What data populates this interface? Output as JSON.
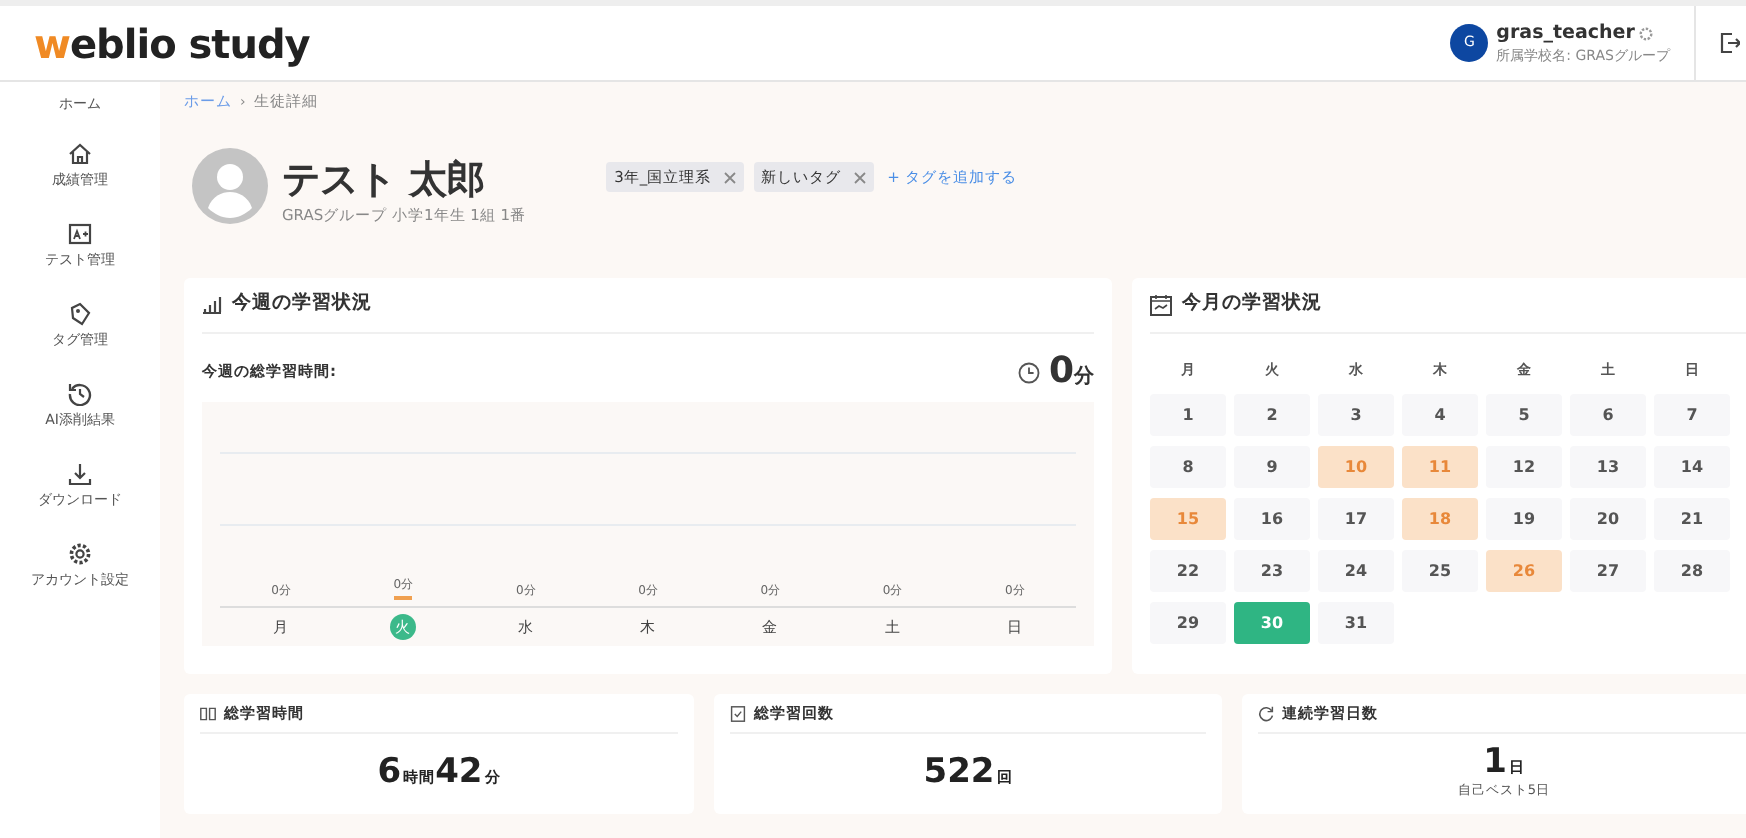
{
  "header": {
    "logo_accent": "w",
    "logo_rest": "eblio study",
    "user": {
      "initial": "G",
      "name": "gras_teacher",
      "school": "所属学校名: GRASグループ"
    }
  },
  "sidebar": {
    "items": [
      {
        "label": "ホーム"
      },
      {
        "label": "成績管理"
      },
      {
        "label": "テスト管理"
      },
      {
        "label": "タグ管理"
      },
      {
        "label": "AI添削結果"
      },
      {
        "label": "ダウンロード"
      },
      {
        "label": "アカウント設定"
      }
    ]
  },
  "breadcrumb": {
    "items": [
      "ホーム",
      "生徒詳細"
    ],
    "separator": "›"
  },
  "student": {
    "name": "テスト 太郎",
    "info": "GRASグループ 小学1年生 1組 1番",
    "tags": [
      "3年_国立理系",
      "新しいタグ"
    ],
    "add_tag": "+ タグを追加する"
  },
  "week": {
    "title": "今週の学習状況",
    "total_label": "今週の総学習時間:",
    "total_value": "0",
    "total_unit": "分",
    "days": [
      {
        "day": "月",
        "value": "0分",
        "selected": false
      },
      {
        "day": "火",
        "value": "0分",
        "selected": true
      },
      {
        "day": "水",
        "value": "0分",
        "selected": false
      },
      {
        "day": "木",
        "value": "0分",
        "selected": false
      },
      {
        "day": "金",
        "value": "0分",
        "selected": false
      },
      {
        "day": "土",
        "value": "0分",
        "selected": false
      },
      {
        "day": "日",
        "value": "0分",
        "selected": false
      }
    ]
  },
  "month": {
    "title": "今月の学習状況",
    "weekdays": [
      "月",
      "火",
      "水",
      "木",
      "金",
      "土",
      "日"
    ],
    "days": [
      {
        "label": "1",
        "kind": "normal"
      },
      {
        "label": "2",
        "kind": "normal"
      },
      {
        "label": "3",
        "kind": "normal"
      },
      {
        "label": "4",
        "kind": "normal"
      },
      {
        "label": "5",
        "kind": "normal"
      },
      {
        "label": "6",
        "kind": "normal"
      },
      {
        "label": "7",
        "kind": "normal"
      },
      {
        "label": "8",
        "kind": "normal"
      },
      {
        "label": "9",
        "kind": "normal"
      },
      {
        "label": "10",
        "kind": "studied"
      },
      {
        "label": "11",
        "kind": "studied"
      },
      {
        "label": "12",
        "kind": "normal"
      },
      {
        "label": "13",
        "kind": "normal"
      },
      {
        "label": "14",
        "kind": "normal"
      },
      {
        "label": "15",
        "kind": "studied"
      },
      {
        "label": "16",
        "kind": "normal"
      },
      {
        "label": "17",
        "kind": "normal"
      },
      {
        "label": "18",
        "kind": "studied"
      },
      {
        "label": "19",
        "kind": "normal"
      },
      {
        "label": "20",
        "kind": "normal"
      },
      {
        "label": "21",
        "kind": "normal"
      },
      {
        "label": "22",
        "kind": "normal"
      },
      {
        "label": "23",
        "kind": "normal"
      },
      {
        "label": "24",
        "kind": "normal"
      },
      {
        "label": "25",
        "kind": "normal"
      },
      {
        "label": "26",
        "kind": "studied"
      },
      {
        "label": "27",
        "kind": "normal"
      },
      {
        "label": "28",
        "kind": "normal"
      },
      {
        "label": "29",
        "kind": "normal"
      },
      {
        "label": "30",
        "kind": "today"
      },
      {
        "label": "31",
        "kind": "normal"
      }
    ]
  },
  "stats": [
    {
      "title": "総学習時間",
      "parts": [
        "6",
        "時間",
        "42",
        "分"
      ]
    },
    {
      "title": "総学習回数",
      "parts": [
        "522",
        "回"
      ]
    },
    {
      "title": "連続学習日数",
      "parts": [
        "1",
        "日"
      ],
      "note": "自己ベスト5日"
    }
  ]
}
